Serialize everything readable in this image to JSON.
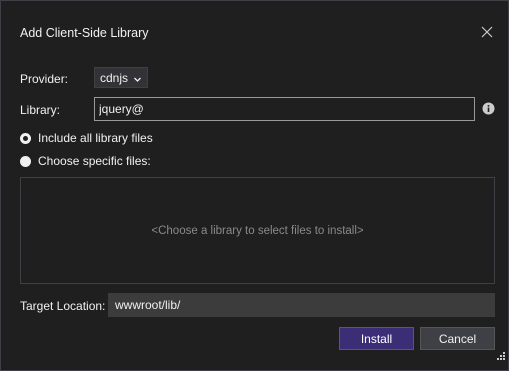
{
  "dialog": {
    "title": "Add Client-Side Library",
    "close_icon": "close-icon"
  },
  "provider": {
    "label": "Provider:",
    "selected": "cdnjs",
    "chevron_icon": "chevron-down-icon"
  },
  "library": {
    "label": "Library:",
    "value": "jquery@",
    "info_icon": "info-icon"
  },
  "file_options": {
    "include_all": {
      "label": "Include all library files",
      "selected": true
    },
    "choose_specific": {
      "label": "Choose specific files:",
      "selected": false
    }
  },
  "files_box": {
    "placeholder": "<Choose a library to select files to install>"
  },
  "target": {
    "label": "Target Location:",
    "value": "wwwroot/lib/"
  },
  "buttons": {
    "install": "Install",
    "cancel": "Cancel"
  },
  "colors": {
    "background": "#1f1f1f",
    "accent": "#3b2e77",
    "text": "#f1f1f1"
  }
}
